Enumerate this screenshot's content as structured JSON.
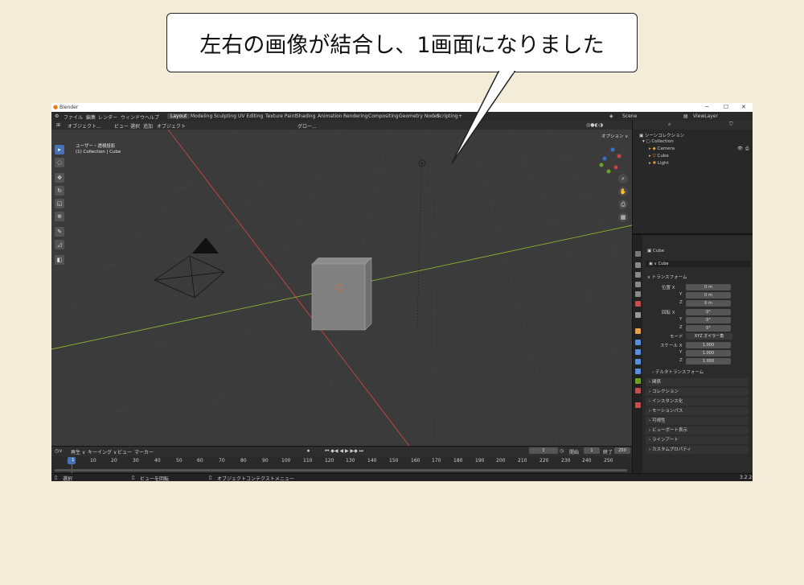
{
  "callout": {
    "text": "左右の画像が結合し、1画面になりました"
  },
  "window": {
    "title": "Blender",
    "minimize": "─",
    "maximize": "☐",
    "close": "✕"
  },
  "menubar": {
    "menus": [
      "ファイル",
      "編集",
      "レンダー",
      "ウィンドウ",
      "ヘルプ"
    ],
    "tabs": [
      "Layout",
      "Modeling",
      "Sculpting",
      "UV Editing",
      "Texture Paint",
      "Shading",
      "Animation",
      "Rendering",
      "Compositing",
      "Geometry Nodes",
      "Scripting"
    ],
    "add_tab": "+",
    "scene": "Scene",
    "view_layer": "ViewLayer"
  },
  "viewport": {
    "mode": "オブジェクト...",
    "menus": [
      "ビュー",
      "選択",
      "追加",
      "オブジェクト"
    ],
    "transform": "グロー...",
    "options": "オプション ∨",
    "view_name": "ユーザー・透視投影",
    "collection_info": "(1) Collection | Cube"
  },
  "outliner": {
    "title": "シーンコレクション",
    "collection": "Collection",
    "items": [
      "Camera",
      "Cube",
      "Light"
    ]
  },
  "properties": {
    "object_name": "Cube",
    "data_name": "Cube",
    "transform_title": "トランスフォーム",
    "location_label": "位置 X",
    "rotation_label": "回転 X",
    "scale_label": "スケール X",
    "y": "Y",
    "z": "Z",
    "location": [
      "0 m",
      "0 m",
      "0 m"
    ],
    "rotation": [
      "0°",
      "0°",
      "0°"
    ],
    "mode_label": "モード",
    "mode_value": "XYZ オイラー角",
    "scale": [
      "1.000",
      "1.000",
      "1.000"
    ],
    "delta_transform": "デルタトランスフォーム",
    "panels": [
      "関係",
      "コレクション",
      "インスタンス化",
      "モーションパス",
      "可視性",
      "ビューポート表示",
      "ラインアート",
      "カスタムプロパティ"
    ]
  },
  "timeline": {
    "menus": [
      "再生 ∨",
      "キーイング ∨",
      "ビュー",
      "マーカー"
    ],
    "current_frame": "1",
    "start_label": "開始",
    "start": "1",
    "end_label": "終了",
    "end": "250",
    "ticks": [
      "10",
      "20",
      "30",
      "40",
      "50",
      "60",
      "70",
      "80",
      "90",
      "100",
      "110",
      "120",
      "130",
      "140",
      "150",
      "160",
      "170",
      "180",
      "190",
      "200",
      "210",
      "220",
      "230",
      "240",
      "250"
    ],
    "marker": "1"
  },
  "statusbar": {
    "select": "選択",
    "rotate": "ビューを回転",
    "context": "オブジェクトコンテクストメニュー",
    "version": "3.2.2"
  },
  "colors": {
    "background": "#f2ecd8",
    "active_blue": "#4772b3",
    "x_axis": "#c94444",
    "y_axis": "#8ab32e"
  }
}
